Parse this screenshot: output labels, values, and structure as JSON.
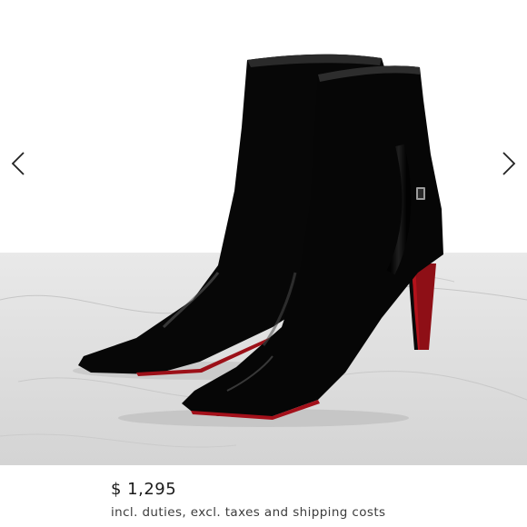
{
  "product": {
    "image_alt": "Black patent leather pointed-toe ankle boots with red soles",
    "price": "$ 1,295",
    "price_note": "incl. duties, excl. taxes and shipping costs"
  },
  "gallery": {
    "prev_icon": "chevron-left-icon",
    "next_icon": "chevron-right-icon"
  },
  "colors": {
    "boot": "#0b0b0b",
    "sole": "#b3121b",
    "wall": "#ffffff",
    "marble": "#dcdcdc"
  }
}
